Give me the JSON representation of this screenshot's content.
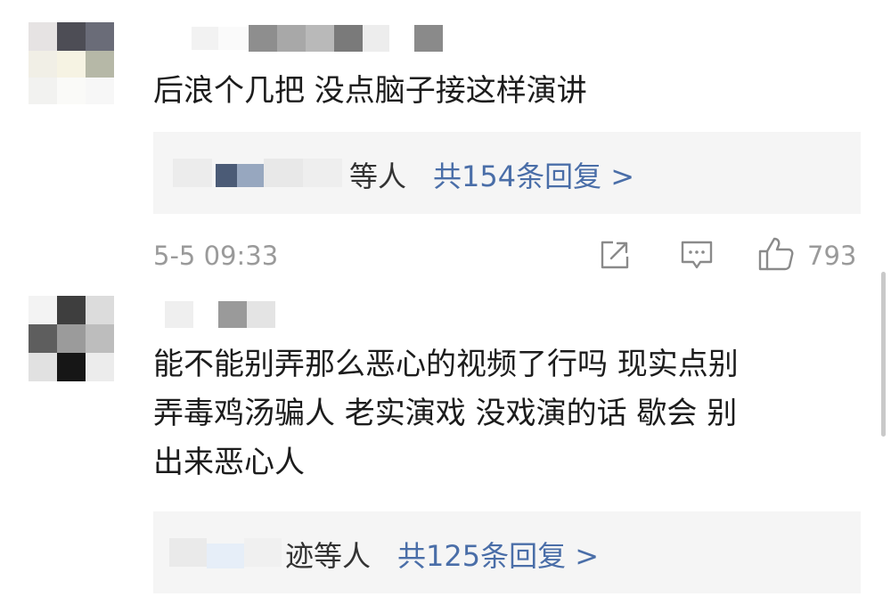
{
  "comments": [
    {
      "text_lines": [
        "后浪个几把 没点脑子接这样演讲"
      ],
      "replies": {
        "names_suffix": "等人",
        "count_label": "共154条回复 >"
      },
      "timestamp": "5-5 09:33",
      "like_count": "793"
    },
    {
      "text_lines": [
        "能不能别弄那么恶心的视频了行吗 现实点别",
        "弄毒鸡汤骗人  老实演戏 没戏演的话 歇会 别",
        "出来恶心人"
      ],
      "replies": {
        "names_suffix": "迹等人",
        "count_label": "共125条回复 >"
      }
    }
  ],
  "icons": {
    "share": "share-icon",
    "comment": "comment-icon",
    "like": "thumbs-up-icon"
  },
  "colors": {
    "link": "#4a6ea8",
    "reply_bg": "#f5f5f5",
    "meta": "#9a9a9a"
  }
}
